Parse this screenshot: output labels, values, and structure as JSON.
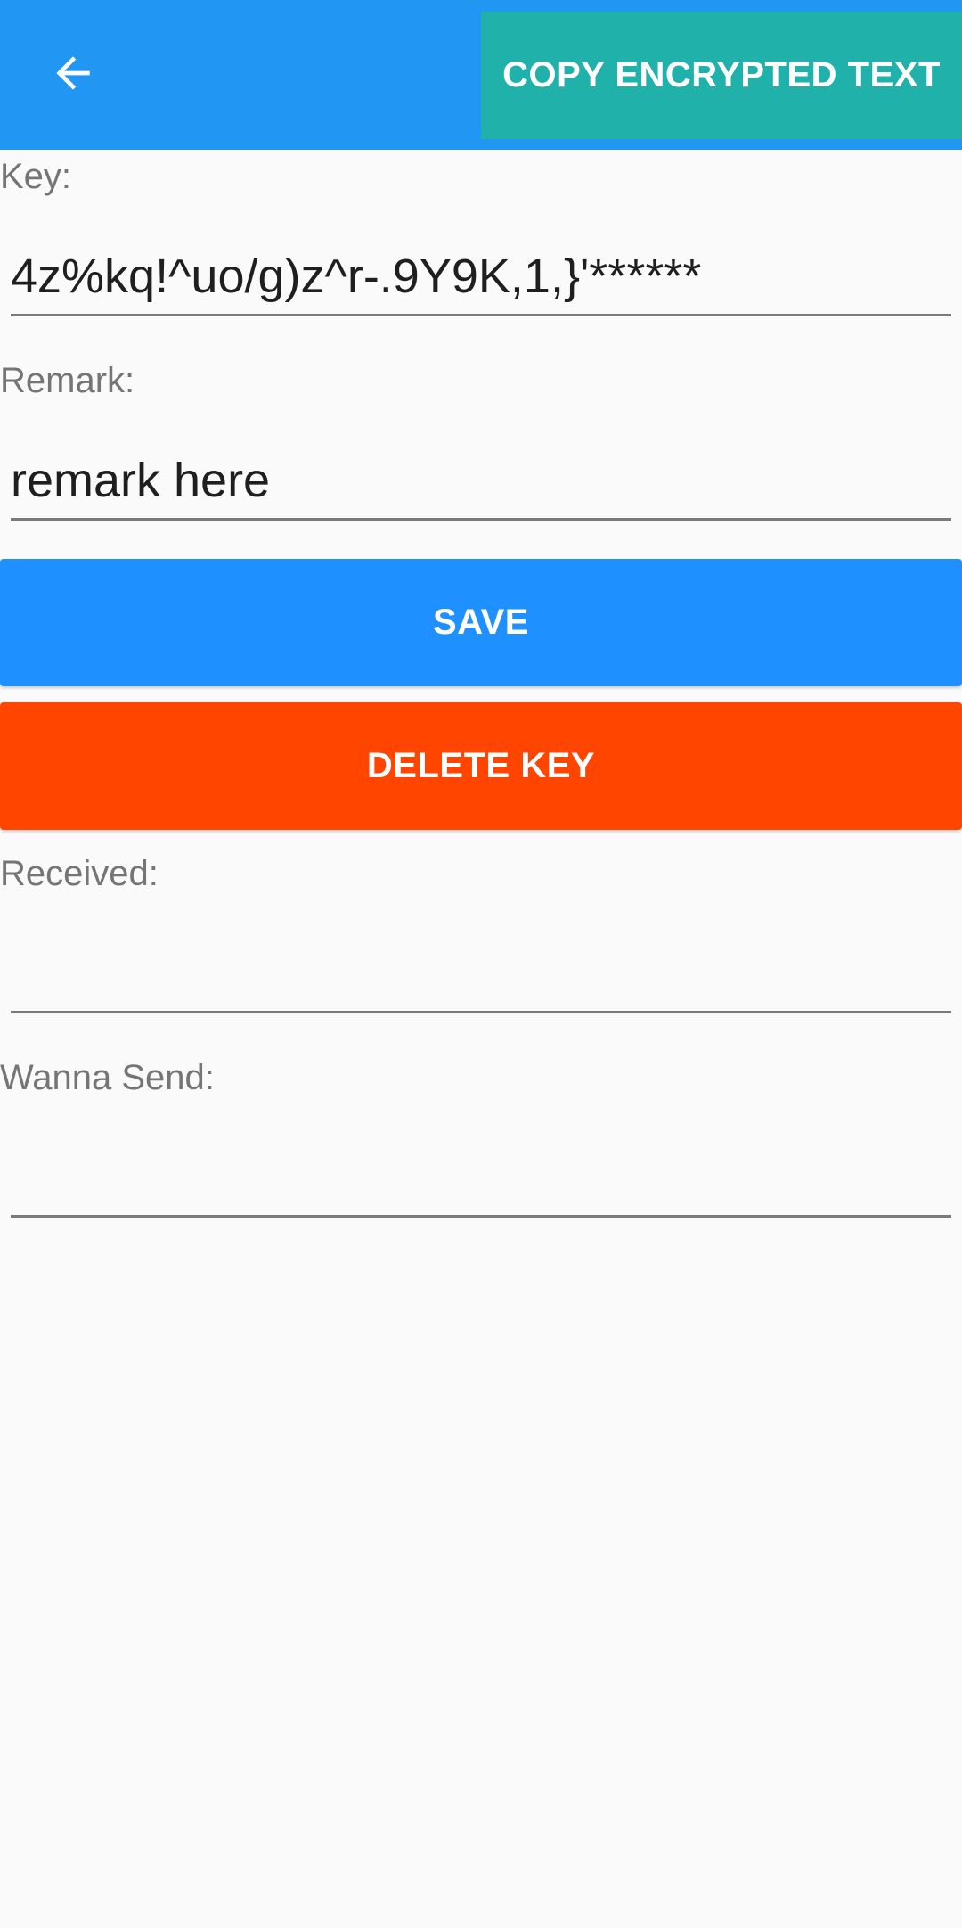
{
  "app_bar": {
    "back_icon": "arrow-left-icon",
    "copy_label": "COPY ENCRYPTED TEXT",
    "background_color": "#2196f3",
    "copy_button_color": "#20b2aa"
  },
  "form": {
    "key_label": "Key:",
    "key_value": "4z%kq!^uo/g)z^r-.9Y9K,1,}'******",
    "remark_label": "Remark:",
    "remark_value": "remark here",
    "received_label": "Received:",
    "received_value": "",
    "send_label": "Wanna Send:",
    "send_value": ""
  },
  "actions": {
    "save_label": "SAVE",
    "save_color": "#1e90ff",
    "delete_label": "DELETE KEY",
    "delete_color": "#ff4500"
  }
}
